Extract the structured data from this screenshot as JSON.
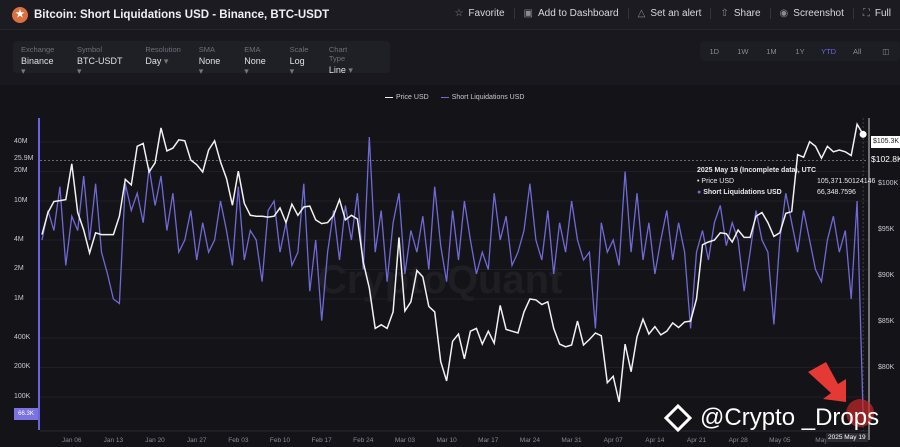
{
  "header": {
    "title": "Bitcoin: Short Liquidations USD - Binance, BTC-USDT",
    "actions": [
      {
        "icon": "star-icon",
        "label": "Favorite"
      },
      {
        "icon": "dashboard-icon",
        "label": "Add to Dashboard"
      },
      {
        "icon": "bell-icon",
        "label": "Set an alert"
      },
      {
        "icon": "share-icon",
        "label": "Share"
      },
      {
        "icon": "camera-icon",
        "label": "Screenshot"
      },
      {
        "icon": "fullscreen-icon",
        "label": "Full"
      }
    ]
  },
  "controls": [
    {
      "label": "Exchange",
      "value": "Binance"
    },
    {
      "label": "Symbol",
      "value": "BTC-USDT"
    },
    {
      "label": "Resolution",
      "value": "Day"
    },
    {
      "label": "SMA",
      "value": "None"
    },
    {
      "label": "EMA",
      "value": "None"
    },
    {
      "label": "Scale",
      "value": "Log"
    },
    {
      "label": "Chart Type",
      "value": "Line"
    }
  ],
  "ranges": [
    "1D",
    "1W",
    "1M",
    "1Y",
    "YTD",
    "All"
  ],
  "active_range": "YTD",
  "watermark": "CryptoQuant",
  "credit": "@Crypto _Drops",
  "tooltip": {
    "title": "2025 May 19 (Incomplete data), UTC",
    "price_label": "Price USD",
    "price_value": "105,371.50124146",
    "liq_label": "Short Liquidations USD",
    "liq_value": "66,348.7596"
  },
  "colors": {
    "price": "#f2f2f2",
    "liq": "#7069d6",
    "accent": "#6c63e0",
    "arrow": "#e53935"
  },
  "chart_data": {
    "type": "line",
    "title": "Bitcoin: Short Liquidations USD - Binance, BTC-USDT",
    "legend": [
      "Price USD",
      "Short Liquidations USD"
    ],
    "legend_placement": "top-center",
    "x_start": "2025-01-01",
    "x_end": "2025-05-19",
    "x_ticks": [
      "Jan 06",
      "Jan 13",
      "Jan 20",
      "Jan 27",
      "Feb 03",
      "Feb 10",
      "Feb 17",
      "Feb 24",
      "Mar 03",
      "Mar 10",
      "Mar 17",
      "Mar 24",
      "Mar 31",
      "Apr 07",
      "Apr 14",
      "Apr 21",
      "Apr 28",
      "May 05",
      "May"
    ],
    "x_last_label": "2025 May 19",
    "left_axis": {
      "scale": "log",
      "ticks": [
        "40M",
        "20M",
        "10M",
        "4M",
        "2M",
        "1M",
        "400K",
        "200K",
        "100K"
      ],
      "tick_values": [
        40000000,
        20000000,
        10000000,
        4000000,
        2000000,
        1000000,
        400000,
        200000,
        100000
      ],
      "marker": "25.9M",
      "marker_value": 25900000,
      "current": "66.3K"
    },
    "right_axis": {
      "ticks": [
        "$100K",
        "$95K",
        "$90K",
        "$85K",
        "$80K"
      ],
      "tick_values": [
        100000,
        95000,
        90000,
        85000,
        80000
      ],
      "marker": "$102.8K",
      "marker_value": 102800,
      "current": "$105.3K"
    },
    "series": [
      {
        "name": "Price USD",
        "unit": "K USD",
        "values": [
          94.5,
          96.9,
          98.1,
          98.2,
          98.3,
          102.2,
          96.9,
          95,
          92.5,
          94.7,
          94.5,
          94.5,
          94.5,
          96.5,
          100.5,
          99.9,
          104.1,
          104.4,
          101.3,
          102.3,
          106.1,
          103.6,
          103.9,
          104.8,
          104.7,
          102.6,
          102.1,
          101.3,
          103.7,
          104.7,
          102.4,
          100.6,
          97.7,
          101.4,
          97.9,
          96.6,
          96.5,
          96.5,
          96.4,
          96.5,
          97.4,
          95.8,
          97.8,
          96.6,
          97.5,
          97.6,
          96.1,
          95.7,
          95.8,
          96.6,
          98.3,
          96.1,
          96.6,
          96.2,
          91.5,
          88.7,
          84.3,
          84.7,
          84.3,
          86.1,
          94.2,
          86.2,
          87.2,
          90.6,
          89.9,
          86.7,
          86.1,
          80.7,
          78.6,
          82.9,
          83.7,
          81.0,
          84.0,
          84.3,
          82.6,
          84.0,
          82.7,
          86.8,
          84.2,
          84.0,
          83.8,
          86.1,
          87.5,
          87.4,
          86.9,
          87.2,
          84.3,
          82.6,
          82.3,
          82.5,
          85.1,
          82.5,
          83.1,
          83.8,
          83.5,
          78.4,
          79.1,
          76.3,
          82.6,
          79.6,
          83.4,
          85.3,
          83.7,
          84.5,
          83.6,
          84.0,
          84.9,
          84.4,
          85.0,
          85.1,
          87.5,
          93.4,
          93.7,
          93.9,
          94.7,
          94.6,
          93.7,
          95.0,
          94.2,
          94.2,
          96.5,
          96.9,
          95.8,
          94.3,
          94.7,
          96.8,
          97.0,
          103.2,
          102.9,
          104.6,
          104.1,
          102.8,
          104.1,
          103.5,
          103.7,
          103.5,
          103.1,
          106.5,
          105.4
        ]
      },
      {
        "name": "Short Liquidations USD",
        "unit": "M USD",
        "values": [
          4,
          8,
          5,
          14,
          2.2,
          7,
          5,
          18,
          4,
          15,
          3,
          1.8,
          1,
          0.9,
          15,
          8,
          12,
          6,
          22,
          9,
          18,
          5,
          12,
          3,
          4,
          8,
          2.5,
          6,
          3,
          4,
          10,
          5,
          2.2,
          14,
          2.5,
          5,
          4,
          1.5,
          8,
          10,
          3,
          6,
          2.2,
          3,
          15,
          1.2,
          4,
          0.6,
          3,
          8,
          2.5,
          9,
          4,
          12,
          2,
          45,
          3,
          8,
          1.5,
          6,
          12,
          1.8,
          5,
          3,
          7,
          2,
          14,
          3.5,
          1.5,
          8,
          2.5,
          10,
          4,
          1.8,
          3,
          2,
          12,
          4,
          7,
          2.2,
          3,
          5,
          15,
          4,
          2.5,
          8,
          1.8,
          6,
          3,
          10,
          4,
          2.5,
          3,
          0.5,
          6,
          3,
          4,
          2.2,
          20,
          3,
          12,
          2.5,
          6,
          1.8,
          4,
          8,
          2.5,
          6,
          3,
          0.5,
          3,
          5,
          2.5,
          6,
          9,
          3.5,
          6,
          4,
          1.2,
          3,
          8,
          4,
          3,
          0.55,
          4,
          12,
          6,
          3,
          8,
          4,
          2,
          1.5,
          4,
          7,
          3,
          5,
          1,
          10,
          0.066
        ]
      }
    ]
  }
}
